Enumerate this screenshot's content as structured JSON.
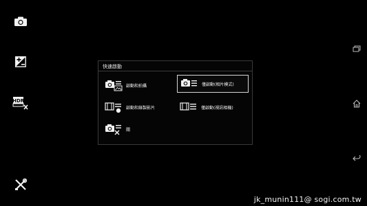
{
  "left_toolbar": {
    "items": [
      {
        "name": "camera-icon"
      },
      {
        "name": "exposure-icon"
      },
      {
        "name": "hdr-off-icon",
        "label": "HDR"
      },
      {
        "name": "tools-icon"
      }
    ]
  },
  "right_nav": {
    "items": [
      {
        "name": "recent-apps-icon"
      },
      {
        "name": "home-icon"
      },
      {
        "name": "back-icon"
      }
    ]
  },
  "quick_launch_dialog": {
    "title": "快速啟動",
    "options": {
      "launch_and_capture": "啟動和拍攝",
      "launch_only_photo": "僅啟動(相片模式)",
      "launch_and_record": "啟動和錄製影片",
      "launch_only_video": "僅啟動(視訊相機)",
      "off": "關"
    },
    "selected": "launch_only_photo"
  },
  "watermark": "jk_munin111@ sogi.com.tw",
  "colors": {
    "background": "#000000",
    "dialog_border": "#3a3a3a",
    "selected_border": "#d8d8d8",
    "text": "#ffffff"
  }
}
